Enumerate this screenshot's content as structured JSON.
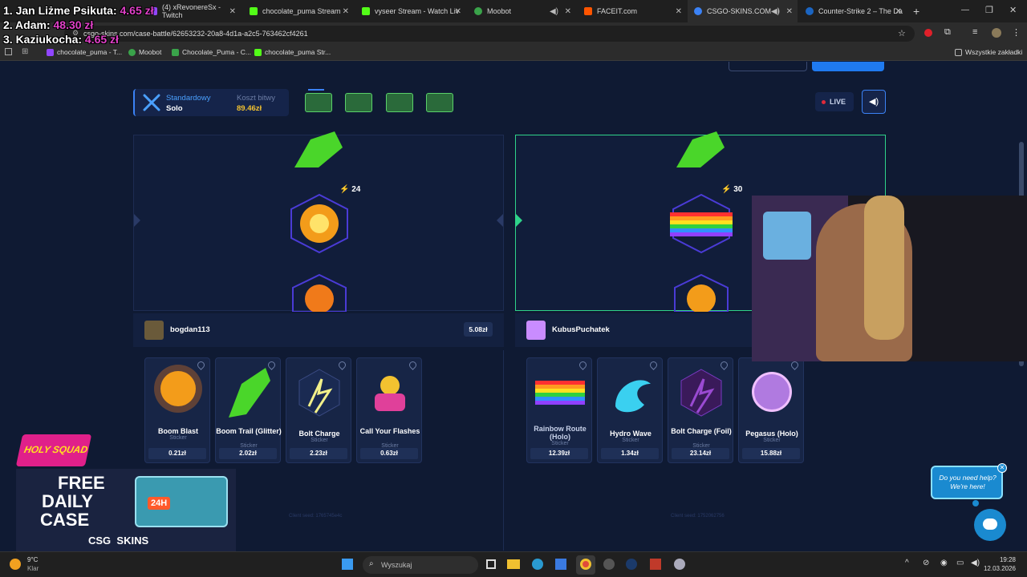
{
  "tabs": [
    {
      "label": "(4) xRevonereSx - Twitch",
      "color": "#9146ff"
    },
    {
      "label": "chocolate_puma Stream",
      "color": "#53fc18"
    },
    {
      "label": "vyseer Stream - Watch Liv",
      "color": "#53fc18"
    },
    {
      "label": "Moobot",
      "color": "#3aa34a"
    },
    {
      "label": "FACEIT.com",
      "color": "#ff5500"
    },
    {
      "label": "CSGO-SKINS.COM - I",
      "color": "#3b82f6"
    },
    {
      "label": "Counter-Strike 2 – The Da",
      "color": "#1b65c2"
    }
  ],
  "address": {
    "url": "csgo-skins.com/case-battle/62653232-20a8-4d1a-a2c5-763462cf4261"
  },
  "bookmarks": [
    "chocolate_puma - T...",
    "Moobot",
    "Chocolate_Puma - C...",
    "chocolate_puma Str..."
  ],
  "bookmarks_all": "Wszystkie zakładki",
  "leaderboard": [
    {
      "name": "1. Jan Liżme Psikuta:",
      "amount": "4.65 zł"
    },
    {
      "name": "2. Adam:",
      "amount": "48.30 zł"
    },
    {
      "name": "3. Kaziukocha:",
      "amount": "4.65 zł"
    }
  ],
  "battle": {
    "mode_label": "Standardowy",
    "mode_value": "Solo",
    "cost_label": "Koszt bitwy",
    "cost_value": "89.46zł",
    "live_label": "LIVE"
  },
  "players": [
    {
      "name": "bogdan113",
      "total": "5.08zł",
      "spin_value": "24",
      "items": [
        {
          "name": "Boom Blast",
          "type": "Sticker",
          "price": "0.21zł"
        },
        {
          "name": "Boom Trail (Glitter)",
          "type": "Sticker",
          "price": "2.02zł"
        },
        {
          "name": "Bolt Charge",
          "type": "Sticker",
          "price": "2.23zł"
        },
        {
          "name": "Call Your Flashes",
          "type": "Sticker",
          "price": "0.63zł"
        }
      ],
      "seed": "Client seed: 1765745e4c"
    },
    {
      "name": "KubusPuchatek",
      "total": "",
      "spin_value": "30",
      "items": [
        {
          "name": "Rainbow Route (Holo)",
          "type": "Sticker",
          "price": "12.39zł"
        },
        {
          "name": "Hydro Wave",
          "type": "Sticker",
          "price": "1.34zł"
        },
        {
          "name": "Bolt Charge (Foil)",
          "type": "Sticker",
          "price": "23.14zł"
        },
        {
          "name": "Pegasus (Holo)",
          "type": "Sticker",
          "price": "15.88zł"
        }
      ],
      "seed": "Client seed: 1752062756"
    }
  ],
  "promo": {
    "brand": "HOLY SQUAD",
    "line1": "FREE",
    "line2": "DAILY",
    "line3": "CASE",
    "badge": "24H",
    "footer": "CSG  SKINS"
  },
  "help": {
    "text": "Do you need help? We're here!"
  },
  "taskbar": {
    "weather_temp": "9°C",
    "weather_desc": "Klar",
    "search_placeholder": "Wyszukaj",
    "time": "19:28",
    "date": "12.03.2026"
  }
}
